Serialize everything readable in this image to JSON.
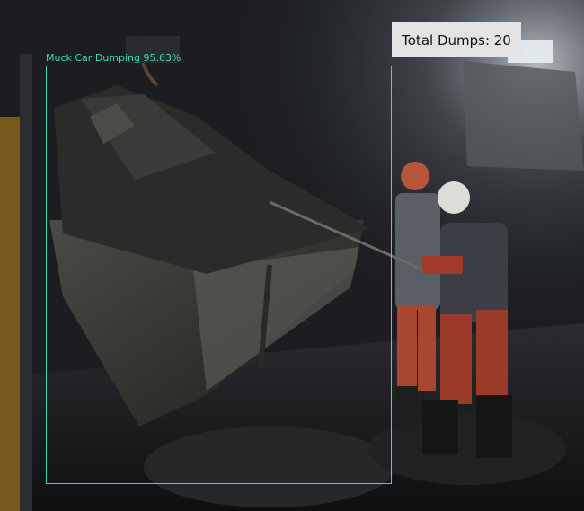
{
  "detection": {
    "label": "Muck Car Dumping 95.63%",
    "color": "#3fd8b8"
  },
  "counter": {
    "text": "Total Dumps: 20"
  }
}
